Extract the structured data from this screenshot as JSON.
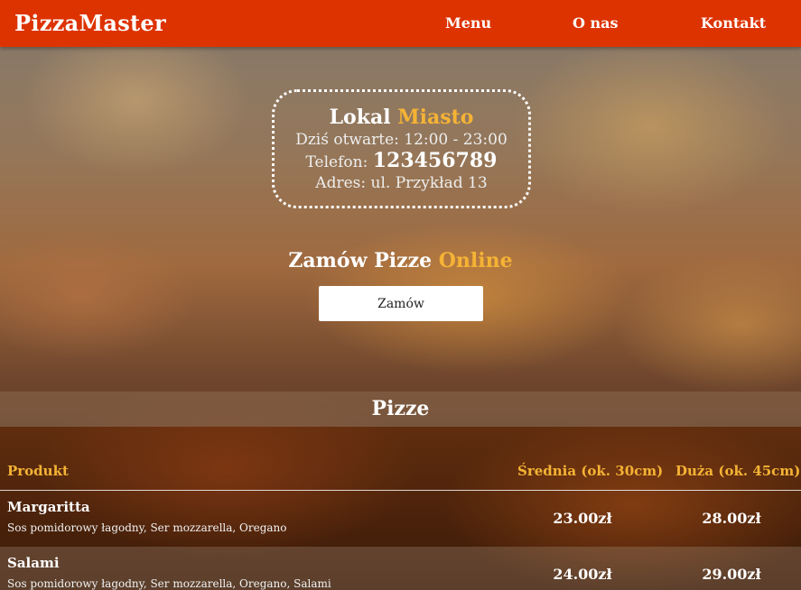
{
  "navbar": {
    "brand": "PizzaMaster",
    "links": [
      {
        "label": "Menu"
      },
      {
        "label": "O nas"
      },
      {
        "label": "Kontakt"
      }
    ]
  },
  "info": {
    "title_prefix": "Lokal",
    "title_city": "Miasto",
    "hours": "Dziś otwarte: 12:00 - 23:00",
    "phone_label": "Telefon:",
    "phone_number": "123456789",
    "address": "Adres: ul. Przykład 13"
  },
  "order": {
    "heading_prefix": "Zamów Pizze",
    "heading_accent": "Online",
    "button_label": "Zamów"
  },
  "menu": {
    "section_title": "Pizze",
    "columns": [
      "Produkt",
      "Średnia (ok. 30cm)",
      "Duża (ok. 45cm)"
    ],
    "items": [
      {
        "name": "Margaritta",
        "description": "Sos pomidorowy łagodny, Ser mozzarella, Oregano",
        "price_medium": "23.00zł",
        "price_large": "28.00zł"
      },
      {
        "name": "Salami",
        "description": "Sos pomidorowy łagodny, Ser mozzarella, Oregano, Salami",
        "price_medium": "24.00zł",
        "price_large": "29.00zł"
      }
    ]
  },
  "colors": {
    "navbar": "#dd3300",
    "accent": "#f5b335"
  }
}
